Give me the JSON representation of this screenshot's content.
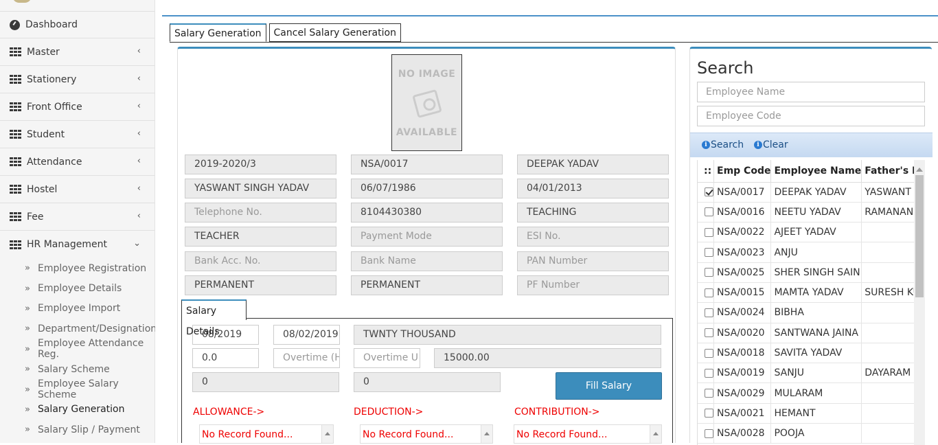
{
  "sidebar": {
    "items": [
      {
        "label": "Dashboard",
        "icon": "dashboard-icon"
      },
      {
        "label": "Master",
        "icon": "grid-icon"
      },
      {
        "label": "Stationery",
        "icon": "grid-icon"
      },
      {
        "label": "Front Office",
        "icon": "grid-icon"
      },
      {
        "label": "Student",
        "icon": "grid-icon"
      },
      {
        "label": "Attendance",
        "icon": "grid-icon"
      },
      {
        "label": "Hostel",
        "icon": "grid-icon"
      },
      {
        "label": "Fee",
        "icon": "grid-icon"
      },
      {
        "label": "HR Management",
        "icon": "grid-icon"
      }
    ],
    "hr_submenu": [
      "Employee Registration",
      "Employee Details",
      "Employee Import",
      "Department/Designation",
      "Employee Attendance Reg.",
      "Salary Scheme",
      "Employee Salary Scheme",
      "Salary Generation",
      "Salary Slip / Payment"
    ],
    "chevron": "‹",
    "chevron_open": "⌄",
    "sub_marker": "»"
  },
  "tabs": {
    "active": "Salary Generation",
    "other": "Cancel Salary Generation"
  },
  "photo": {
    "line1": "NO IMAGE",
    "line2": "AVAILABLE"
  },
  "employee": {
    "session": "2019-2020/3",
    "emp_code": "NSA/0017",
    "name": "DEEPAK YADAV",
    "father": "YASWANT SINGH YADAV",
    "dob": "06/07/1986",
    "doj": "04/01/2013",
    "telephone_ph": "Telephone No.",
    "mobile": "8104430380",
    "category": "TEACHING",
    "designation": "TEACHER",
    "payment_mode_ph": "Payment Mode",
    "esi_ph": "ESI No.",
    "bank_acc_ph": "Bank Acc. No.",
    "bank_name_ph": "Bank Name",
    "pan_ph": "PAN Number",
    "type1": "PERMANENT",
    "type2": "PERMANENT",
    "pf_ph": "PF Number"
  },
  "salary": {
    "tab": "Salary Details",
    "month": "08/2019",
    "date": "08/02/2019",
    "amount_words": "TWNTY THOUSAND",
    "leave": "0.0",
    "overtime_hours_ph": "Overtime (H",
    "overtime_unit_ph": "Overtime U",
    "amount": "15000.00",
    "val1": "0",
    "val2": "0",
    "fill_button": "Fill Salary",
    "allowance_label": "ALLOWANCE->",
    "deduction_label": "DEDUCTION->",
    "contribution_label": "CONTRIBUTION->",
    "no_record": "No Record Found..."
  },
  "search": {
    "title": "Search",
    "name_ph": "Employee Name",
    "code_ph": "Employee Code",
    "search_btn": "Search",
    "clear_btn": "Clear",
    "columns": [
      "::",
      "Emp Code",
      "Employee Name",
      "Father's Na"
    ],
    "rows": [
      {
        "checked": true,
        "code": "NSA/0017",
        "name": "DEEPAK YADAV",
        "father": "YASWANT S"
      },
      {
        "checked": false,
        "code": "NSA/0016",
        "name": "NEETU YADAV",
        "father": "RAMANAND"
      },
      {
        "checked": false,
        "code": "NSA/0022",
        "name": "AJEET YADAV",
        "father": ""
      },
      {
        "checked": false,
        "code": "NSA/0023",
        "name": "ANJU",
        "father": ""
      },
      {
        "checked": false,
        "code": "NSA/0025",
        "name": "SHER SINGH SAIN",
        "father": ""
      },
      {
        "checked": false,
        "code": "NSA/0015",
        "name": "MAMTA YADAV",
        "father": "SURESH KU"
      },
      {
        "checked": false,
        "code": "NSA/0024",
        "name": "BIBHA",
        "father": ""
      },
      {
        "checked": false,
        "code": "NSA/0020",
        "name": "SANTWANA JAINA",
        "father": ""
      },
      {
        "checked": false,
        "code": "NSA/0018",
        "name": "SAVITA YADAV",
        "father": ""
      },
      {
        "checked": false,
        "code": "NSA/0019",
        "name": "SANJU",
        "father": "DAYARAM"
      },
      {
        "checked": false,
        "code": "NSA/0029",
        "name": "MULARAM",
        "father": ""
      },
      {
        "checked": false,
        "code": "NSA/0021",
        "name": "HEMANT",
        "father": ""
      },
      {
        "checked": false,
        "code": "NSA/0028",
        "name": "POOJA",
        "father": ""
      }
    ]
  }
}
